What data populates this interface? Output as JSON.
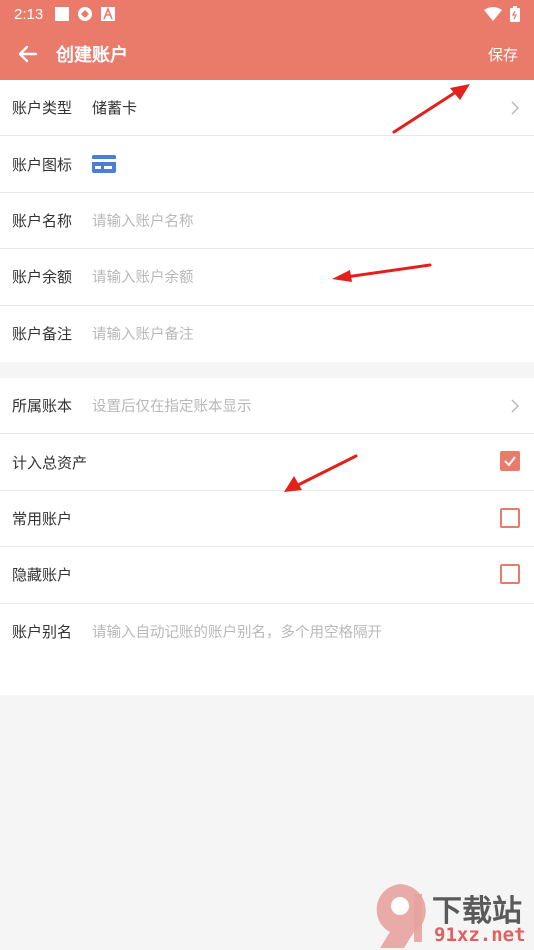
{
  "status": {
    "time": "2:13"
  },
  "header": {
    "title": "创建账户",
    "save_label": "保存"
  },
  "form": {
    "type": {
      "label": "账户类型",
      "value": "储蓄卡"
    },
    "icon": {
      "label": "账户图标",
      "icon": "credit-card-icon"
    },
    "name": {
      "label": "账户名称",
      "placeholder": "请输入账户名称"
    },
    "balance": {
      "label": "账户余额",
      "placeholder": "请输入账户余额"
    },
    "note": {
      "label": "账户备注",
      "placeholder": "请输入账户备注"
    }
  },
  "settings": {
    "book": {
      "label": "所属账本",
      "placeholder": "设置后仅在指定账本显示"
    },
    "total": {
      "label": "计入总资产",
      "checked": true
    },
    "common": {
      "label": "常用账户",
      "checked": false
    },
    "hidden": {
      "label": "隐藏账户",
      "checked": false
    },
    "alias": {
      "label": "账户别名",
      "placeholder": "请输入自动记账的账户别名，多个用空格隔开"
    }
  },
  "watermark": {
    "brand": "下载站",
    "domain": "91xz.net"
  },
  "colors": {
    "accent": "#ea7a6a",
    "annotation": "#e3201b"
  }
}
